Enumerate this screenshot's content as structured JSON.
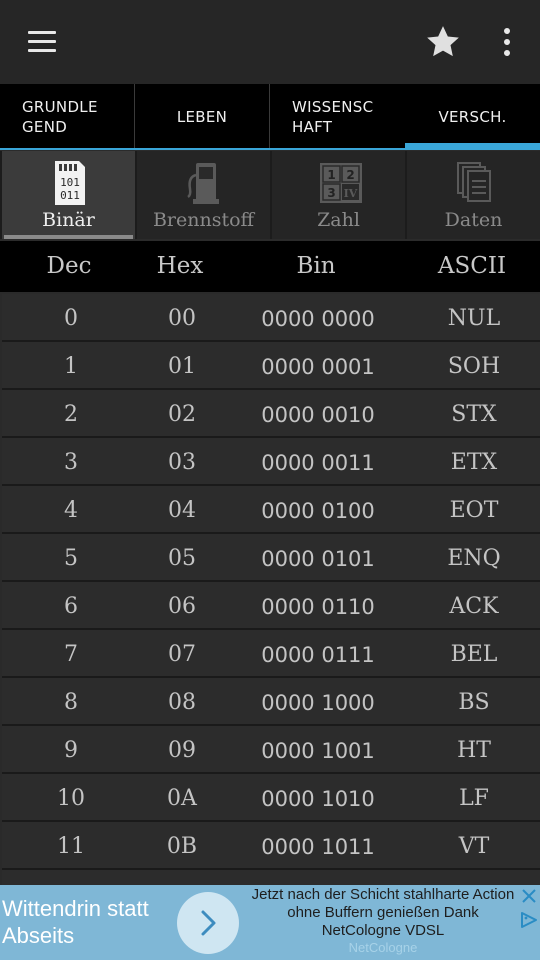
{
  "tabs": [
    {
      "label": "GRUNDLE\nGEND"
    },
    {
      "label": "LEBEN"
    },
    {
      "label": "WISSENSC\nHAFT"
    },
    {
      "label": "VERSCH."
    }
  ],
  "subtabs": [
    {
      "label": "Binär",
      "icon": "binary-file-icon",
      "active": true
    },
    {
      "label": "Brennstoff",
      "icon": "fuel-pump-icon",
      "active": false
    },
    {
      "label": "Zahl",
      "icon": "number-grid-icon",
      "active": false
    },
    {
      "label": "Daten",
      "icon": "documents-icon",
      "active": false
    }
  ],
  "binary_icon_text": [
    "101",
    "011"
  ],
  "number_icon_text": [
    "1",
    "2",
    "3",
    "IV"
  ],
  "table": {
    "headers": [
      "Dec",
      "Hex",
      "Bin",
      "ASCII"
    ],
    "rows": [
      [
        "0",
        "00",
        "0000 0000",
        "NUL"
      ],
      [
        "1",
        "01",
        "0000 0001",
        "SOH"
      ],
      [
        "2",
        "02",
        "0000 0010",
        "STX"
      ],
      [
        "3",
        "03",
        "0000 0011",
        "ETX"
      ],
      [
        "4",
        "04",
        "0000 0100",
        "EOT"
      ],
      [
        "5",
        "05",
        "0000 0101",
        "ENQ"
      ],
      [
        "6",
        "06",
        "0000 0110",
        "ACK"
      ],
      [
        "7",
        "07",
        "0000 0111",
        "BEL"
      ],
      [
        "8",
        "08",
        "0000 1000",
        "BS"
      ],
      [
        "9",
        "09",
        "0000 1001",
        "HT"
      ],
      [
        "10",
        "0A",
        "0000 1010",
        "LF"
      ],
      [
        "11",
        "0B",
        "0000 1011",
        "VT"
      ]
    ]
  },
  "ad": {
    "headline": "Wittendrin statt Abseits",
    "body": "Jetzt nach der Schicht stahlharte Action ohne Buffern genießen Dank NetCologne VDSL",
    "brand": "NetCologne"
  },
  "colors": {
    "accent": "#3aa6d8",
    "background": "#2b2b2b",
    "ad_background": "#7fb7d6"
  }
}
